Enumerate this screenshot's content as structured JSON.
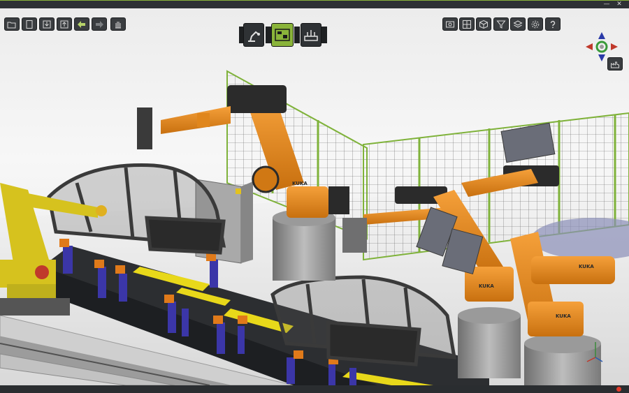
{
  "window": {
    "status": "",
    "controls": {
      "minimize": "—",
      "close": "✕"
    }
  },
  "toolbar_left": [
    {
      "name": "open-folder-button",
      "icon": "folder-open-icon"
    },
    {
      "name": "save-button",
      "icon": "document-icon"
    },
    {
      "name": "import-button",
      "icon": "import-icon"
    },
    {
      "name": "export-button",
      "icon": "export-icon"
    },
    {
      "name": "undo-button",
      "icon": "arrow-left-icon"
    },
    {
      "name": "redo-button",
      "icon": "arrow-right-icon"
    },
    {
      "name": "hand-tool-button",
      "icon": "hand-icon"
    }
  ],
  "mode_buttons": [
    {
      "name": "robot-mode-button",
      "icon": "robot-arm-icon",
      "active": false
    },
    {
      "name": "cell-layout-mode-button",
      "icon": "cell-layout-icon",
      "active": true
    },
    {
      "name": "simulation-mode-button",
      "icon": "simulation-icon",
      "active": false
    }
  ],
  "toolbar_right": [
    {
      "name": "screenshot-button",
      "icon": "camera-icon"
    },
    {
      "name": "grid-view-button",
      "icon": "grid-icon"
    },
    {
      "name": "object-button",
      "icon": "cube-icon"
    },
    {
      "name": "filter-button",
      "icon": "filter-icon"
    },
    {
      "name": "layers-button",
      "icon": "layers-icon"
    },
    {
      "name": "settings-button",
      "icon": "gear-icon"
    },
    {
      "name": "help-button",
      "icon": "question-icon"
    }
  ],
  "side_button": {
    "name": "factory-view-button",
    "icon": "factory-icon"
  },
  "scene": {
    "robot_brand": "KUKA",
    "colors": {
      "accent": "#8ab43a",
      "robot_orange": "#e0861c",
      "robot_yellow": "#d6c21e",
      "fixture_blue": "#3b36a8",
      "fence_green": "#7fb23a",
      "conveyor_yellow": "#e8d81a"
    }
  }
}
